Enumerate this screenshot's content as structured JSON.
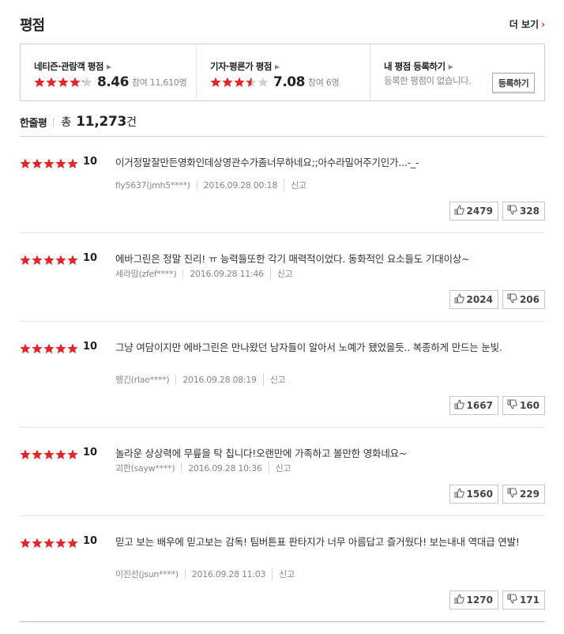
{
  "header": {
    "title": "평점",
    "more_label": "더 보기",
    "more_chevron": "›"
  },
  "summary": {
    "netizen": {
      "label": "네티즌·관람객 평점",
      "rating": 8.46,
      "score": "8.46",
      "participants": "참여 11,610명"
    },
    "critic": {
      "label": "기자·평론가 평점",
      "rating": 7.08,
      "score": "7.08",
      "participants": "참여 6명"
    },
    "mine": {
      "label": "내 평점 등록하기",
      "none_text": "등록한 평점이 없습니다.",
      "button_label": "등록하기"
    }
  },
  "count": {
    "tab_label": "한줄평",
    "total_label": "총",
    "total": "11,273",
    "unit": "건"
  },
  "colors": {
    "star": "#e3252a",
    "star_empty": "#d2d2d2",
    "accent": "#e3252a"
  },
  "reviews": [
    {
      "rating": 10,
      "score": "10",
      "text": "이거정말잘만든영화인데상영관수가좀너무하네요;;아수라밀어주기인가...-_-",
      "user": "fly5637(jmh5****)",
      "date": "2016.09.28 00:18",
      "report": "신고",
      "likes": "2479",
      "dislikes": "328"
    },
    {
      "rating": 10,
      "score": "10",
      "text": "에바그린은 정말 진리! ㅠ 능력들또한 각기 매력적이었다. 동화적인 요소들도 기대이상~",
      "user": "세라맘(zfef****)",
      "date": "2016.09.28 11:46",
      "report": "신고",
      "likes": "2024",
      "dislikes": "206"
    },
    {
      "rating": 10,
      "score": "10",
      "text": "그냥 여담이지만 에바그린은 만나왔던 남자들이 알아서 노예가 됐었을듯.. 복종하게 만드는 눈빛.",
      "user": "펭긴(rlae****)",
      "date": "2016.09.28 08:19",
      "report": "신고",
      "likes": "1667",
      "dislikes": "160"
    },
    {
      "rating": 10,
      "score": "10",
      "text": "놀라운 상상력에 무릎을 탁 칩니다!오랜만에 가족하고 볼만한 영화네요~",
      "user": "괴한(sayw****)",
      "date": "2016.09.28 10:36",
      "report": "신고",
      "likes": "1560",
      "dislikes": "229"
    },
    {
      "rating": 10,
      "score": "10",
      "text": "믿고 보는 배우에 믿고보는 감독! 팀버튼표 판타지가 너무 아름답고 즐거웠다! 보는내내 역대급 연발!",
      "user": "이진선(jsun****)",
      "date": "2016.09.28 11:03",
      "report": "신고",
      "likes": "1270",
      "dislikes": "171"
    }
  ]
}
